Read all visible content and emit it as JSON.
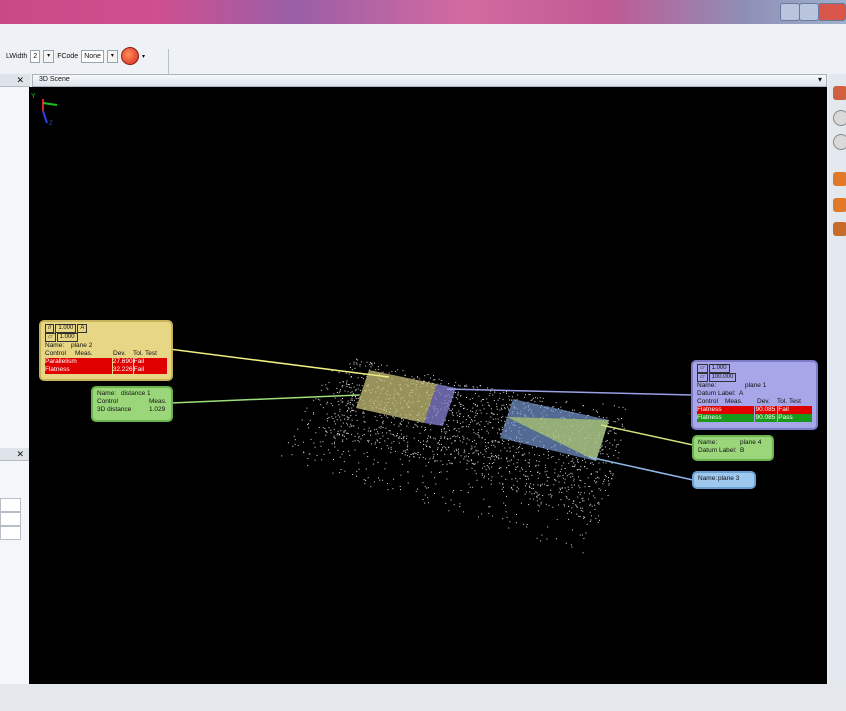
{
  "toolbar": {
    "lwidth_label": "LWidth",
    "lwidth_value": "2",
    "fcode_label": "FCode",
    "fcode_value": "None"
  },
  "scene": {
    "title": "3D Scene",
    "axes": {
      "y": "Y",
      "z": "Z"
    }
  },
  "labels": {
    "plane2": {
      "tol_parallel": "1.000",
      "datum_ref": "A",
      "tol_flatness": "1.000",
      "name_key": "Name:",
      "name_val": "plane 2",
      "cols": [
        "Control",
        "Meas.",
        "Dev.",
        "Tol.",
        "Test"
      ],
      "rows": [
        {
          "control": "Parallelism",
          "dev": "27.690",
          "test": "Fail"
        },
        {
          "control": "Flatness",
          "dev": "32.226",
          "test": "Fail"
        }
      ]
    },
    "distance1": {
      "name_key": "Name:",
      "name_val": "distance 1",
      "control_key": "Control",
      "meas_key": "Meas.",
      "row_label": "3D distance",
      "row_value": "1.029"
    },
    "plane1": {
      "tol_flatness": "1.000",
      "tol_flatness2": "100.000",
      "name_key": "Name:",
      "name_val": "plane 1",
      "datum_key": "Datum Label:",
      "datum_val": "A",
      "cols": [
        "Control",
        "Meas.",
        "Dev.",
        "Tol.",
        "Test"
      ],
      "rows": [
        {
          "control": "Flatness",
          "dev": "90.085",
          "test": "Fail"
        },
        {
          "control": "Flatness",
          "dev": "90.085",
          "test": "Pass"
        }
      ]
    },
    "plane4": {
      "name_key": "Name:",
      "name_val": "plane 4",
      "datum_key": "Datum Label:",
      "datum_val": "B"
    },
    "plane3": {
      "name_key": "Name:",
      "name_val": "plane 3"
    }
  },
  "colors": {
    "scene_bg": "#000000",
    "fail": "#e00000",
    "pass": "#1a9a1a",
    "label_yellow": "#e7d684",
    "label_green": "#9bd77a",
    "label_purple": "#a6a6e8",
    "label_blue": "#9ec8ee"
  },
  "icons": [
    "tool-wrench-icon",
    "scene-menu-icon",
    "close-icon",
    "measure-icon",
    "zoom-icon",
    "rotate-icon",
    "cube-icon",
    "shield-icon",
    "grid-icon"
  ]
}
